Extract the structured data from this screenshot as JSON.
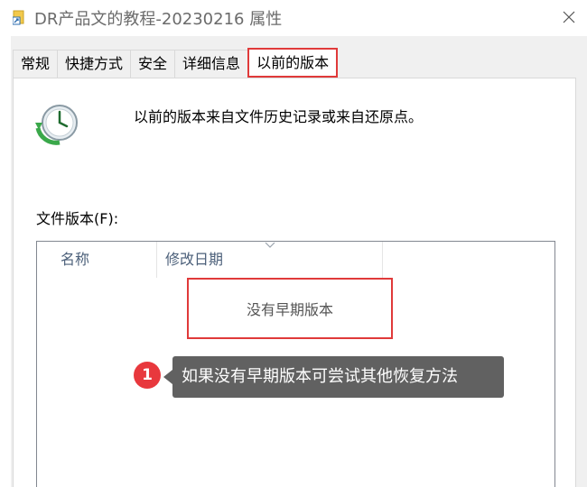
{
  "window": {
    "title": "DR产品文的教程-20230216 属性"
  },
  "tabs": [
    {
      "label": "常规",
      "active": false
    },
    {
      "label": "快捷方式",
      "active": false
    },
    {
      "label": "安全",
      "active": false
    },
    {
      "label": "详细信息",
      "active": false
    },
    {
      "label": "以前的版本",
      "active": true
    }
  ],
  "panel": {
    "description": "以前的版本来自文件历史记录或来自还原点。",
    "list_label": "文件版本(F):",
    "columns": [
      "名称",
      "修改日期"
    ],
    "empty_message": "没有早期版本"
  },
  "annotation": {
    "number": "1",
    "text": "如果没有早期版本可尝试其他恢复方法"
  },
  "colors": {
    "highlight": "#e03a3a",
    "header_text": "#4c607a",
    "callout_bg": "#616161"
  },
  "icons": {
    "title": "folder-shortcut-icon",
    "close": "close-icon",
    "history": "restore-clock-icon"
  }
}
